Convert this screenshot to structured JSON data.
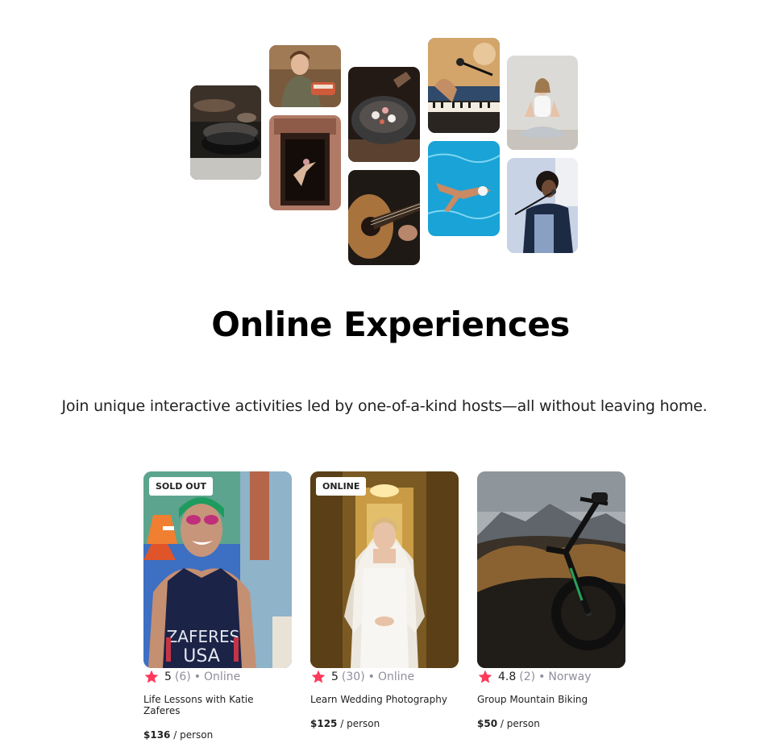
{
  "hero": {
    "tiles": [
      {
        "name": "cooking-pan-photo"
      },
      {
        "name": "baking-woman-photo"
      },
      {
        "name": "dancer-doorway-photo"
      },
      {
        "name": "food-bowl-photo"
      },
      {
        "name": "guitar-photo"
      },
      {
        "name": "piano-microphone-photo"
      },
      {
        "name": "swimmer-photo"
      },
      {
        "name": "yoga-photo"
      },
      {
        "name": "singer-photo"
      }
    ]
  },
  "heading": "Online Experiences",
  "subheading": "Join unique interactive activities led by one-of-a-kind hosts—all without leaving home.",
  "cards": [
    {
      "badge": "SOLD OUT",
      "rating": "5",
      "review_count": "(6)",
      "separator": "•",
      "location": "Online",
      "title": "Life Lessons with Katie Zaferes",
      "price": "$136",
      "price_unit": " / person",
      "photo_text_1": "ZAFERES",
      "photo_text_2": "USA"
    },
    {
      "badge": "ONLINE",
      "rating": "5",
      "review_count": "(30)",
      "separator": "•",
      "location": "Online",
      "title": "Learn Wedding Photography",
      "price": "$125",
      "price_unit": " / person"
    },
    {
      "badge": "",
      "rating": "4.8",
      "review_count": "(2)",
      "separator": "•",
      "location": "Norway",
      "title": "Group Mountain Biking",
      "price": "$50",
      "price_unit": " / person"
    }
  ],
  "colors": {
    "star": "#fe395c",
    "muted_text": "#918e9b",
    "text": "#222222"
  }
}
